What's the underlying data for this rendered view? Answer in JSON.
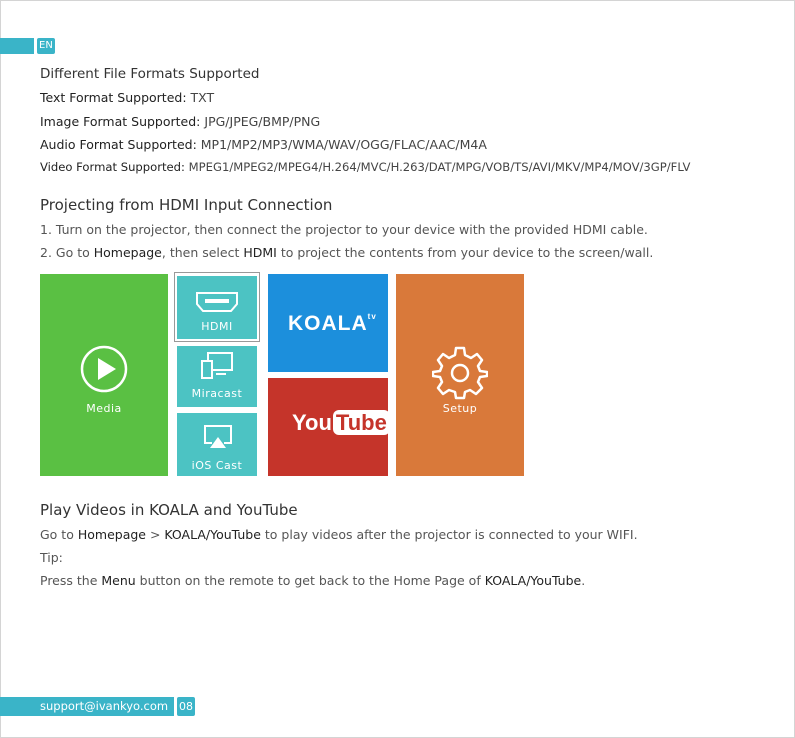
{
  "header": {
    "lang": "EN"
  },
  "formats": {
    "title": "Different File Formats Supported",
    "text_label": "Text Format Supported:",
    "text_value": " TXT",
    "image_label": "Image Format Supported:",
    "image_value": " JPG/JPEG/BMP/PNG",
    "audio_label": "Audio Format Supported:",
    "audio_value": " MP1/MP2/MP3/WMA/WAV/OGG/FLAC/AAC/M4A",
    "video_label": "Video Format Supported:",
    "video_value": " MPEG1/MPEG2/MPEG4/H.264/MVC/H.263/DAT/MPG/VOB/TS/AVI/MKV/MP4/MOV/3GP/FLV"
  },
  "hdmi_section": {
    "title": "Projecting from HDMI Input Connection",
    "step1": "1. Turn on the projector, then connect the projector to your device with the provided HDMI cable.",
    "step2_a": "2. Go to ",
    "step2_b": "Homepage",
    "step2_c": ", then select ",
    "step2_d": "HDMI",
    "step2_e": " to project the contents from your device to the screen/wall."
  },
  "tiles": {
    "media": "Media",
    "hdmi": "HDMI",
    "miracast": "Miracast",
    "ioscast": "iOS Cast",
    "koala_logo": "KOALA",
    "koala_tv": "tv",
    "youtube_you": "You",
    "youtube_tube": "Tube",
    "setup": "Setup"
  },
  "videos_section": {
    "title": "Play Videos in KOALA and YouTube",
    "line1_a": "Go to ",
    "line1_b": "Homepage",
    "line1_c": " > ",
    "line1_d": "KOALA/YouTube",
    "line1_e": " to play videos after the projector is connected to your WIFI.",
    "tip": "Tip:",
    "line2_a": "Press the ",
    "line2_b": "Menu",
    "line2_c": " button on the remote to get back to the Home Page of ",
    "line2_d": "KOALA/YouTube",
    "line2_e": "."
  },
  "footer": {
    "email": "support@ivankyo.com",
    "page": "08"
  },
  "colors": {
    "accent": "#3ab4c8",
    "media": "#5ac043",
    "cast": "#4cc3c3",
    "koala": "#1c8fdc",
    "youtube": "#c5342a",
    "setup": "#d9793a"
  }
}
